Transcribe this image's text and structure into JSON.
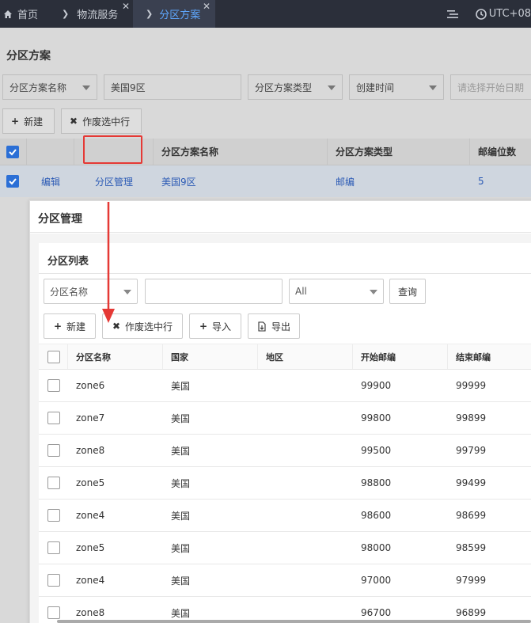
{
  "tabs": {
    "home": "首页",
    "logistics": "物流服务",
    "active": "分区方案"
  },
  "header": {
    "timezone": "UTC+08"
  },
  "page": {
    "title": "分区方案",
    "filters": {
      "name_select": "分区方案名称",
      "name_value": "美国9区",
      "type_select": "分区方案类型",
      "time_select": "创建时间",
      "date_placeholder": "请选择开始日期"
    },
    "buttons": {
      "new": "新建",
      "void": "作废选中行"
    },
    "table": {
      "columns": [
        "分区方案名称",
        "分区方案类型",
        "邮编位数"
      ],
      "row": {
        "edit": "编辑",
        "manage": "分区管理",
        "name": "美国9区",
        "type": "邮编",
        "digits": "5"
      }
    }
  },
  "modal": {
    "title": "分区管理",
    "card_title": "分区列表",
    "filters": {
      "field_select": "分区名称",
      "search_value": "",
      "scope_select": "All",
      "query_button": "查询"
    },
    "buttons": {
      "new": "新建",
      "void": "作废选中行",
      "import": "导入",
      "export": "导出"
    },
    "columns": {
      "name": "分区名称",
      "country": "国家",
      "region": "地区",
      "start_zip": "开始邮编",
      "end_zip": "结束邮编"
    },
    "rows": [
      {
        "name": "zone6",
        "country": "美国",
        "region": "",
        "start": "99900",
        "end": "99999"
      },
      {
        "name": "zone7",
        "country": "美国",
        "region": "",
        "start": "99800",
        "end": "99899"
      },
      {
        "name": "zone8",
        "country": "美国",
        "region": "",
        "start": "99500",
        "end": "99799"
      },
      {
        "name": "zone5",
        "country": "美国",
        "region": "",
        "start": "98800",
        "end": "99499"
      },
      {
        "name": "zone4",
        "country": "美国",
        "region": "",
        "start": "98600",
        "end": "98699"
      },
      {
        "name": "zone5",
        "country": "美国",
        "region": "",
        "start": "98000",
        "end": "98599"
      },
      {
        "name": "zone4",
        "country": "美国",
        "region": "",
        "start": "97000",
        "end": "97999"
      },
      {
        "name": "zone8",
        "country": "美国",
        "region": "",
        "start": "96700",
        "end": "96899"
      }
    ]
  },
  "colors": {
    "annotation": "#e53935",
    "accent": "#2b6fd6",
    "topbar": "#2b2f3a"
  }
}
